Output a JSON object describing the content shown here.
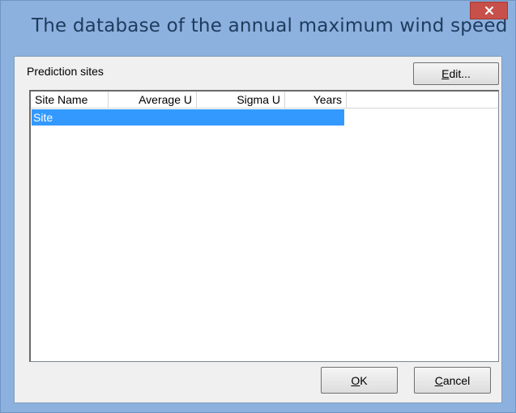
{
  "window": {
    "title": "The database of the annual maximum wind speed",
    "close_symbol": "×",
    "close_icon": "close-icon"
  },
  "prediction": {
    "label": "Prediction sites"
  },
  "buttons": {
    "edit": {
      "mnemonic": "E",
      "rest": "dit..."
    },
    "ok": {
      "mnemonic": "O",
      "rest": "K"
    },
    "cancel": {
      "mnemonic": "C",
      "rest": "ancel"
    }
  },
  "table": {
    "columns": [
      "Site Name",
      "Average U",
      "Sigma U",
      "Years"
    ],
    "rows": [
      {
        "site_name": "Site",
        "average_u": "",
        "sigma_u": "",
        "years": "",
        "selected": true
      }
    ]
  },
  "colors": {
    "title_bar": "#8cb1de",
    "close_button": "#c7504b",
    "selection": "#3399ff"
  }
}
